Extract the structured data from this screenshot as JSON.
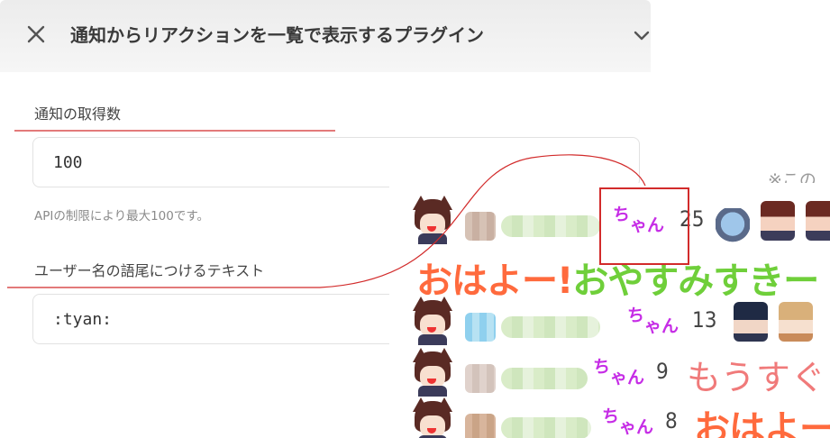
{
  "header": {
    "title": "通知からリアクションを一覧で表示するプラグイン",
    "close_icon": "close-icon",
    "chevron_icon": "chevron-down-icon"
  },
  "fields": {
    "fetch_count": {
      "label": "通知の取得数",
      "value": "100",
      "hint": "APIの制限により最大100です。"
    },
    "suffix_text": {
      "label": "ユーザー名の語尾につけるテキスト",
      "value": ":tyan:"
    }
  },
  "preview": {
    "note": "※この",
    "suffix_display": [
      "ち",
      "ゃん"
    ],
    "rows": [
      {
        "count": "25"
      },
      {
        "count": "13"
      },
      {
        "count": "9",
        "message": "もうすぐ"
      },
      {
        "count": "8",
        "message": "おはよー"
      }
    ],
    "big_message": {
      "part1": "おはよー!",
      "part2": "おやすみすきー"
    }
  },
  "colors": {
    "annotation_red": "#d22b2b",
    "suffix_purple": "#c62de6",
    "message_orange": "#ff6a3d",
    "message_green": "#6fcf3a",
    "message_pink": "#f07a7a"
  }
}
